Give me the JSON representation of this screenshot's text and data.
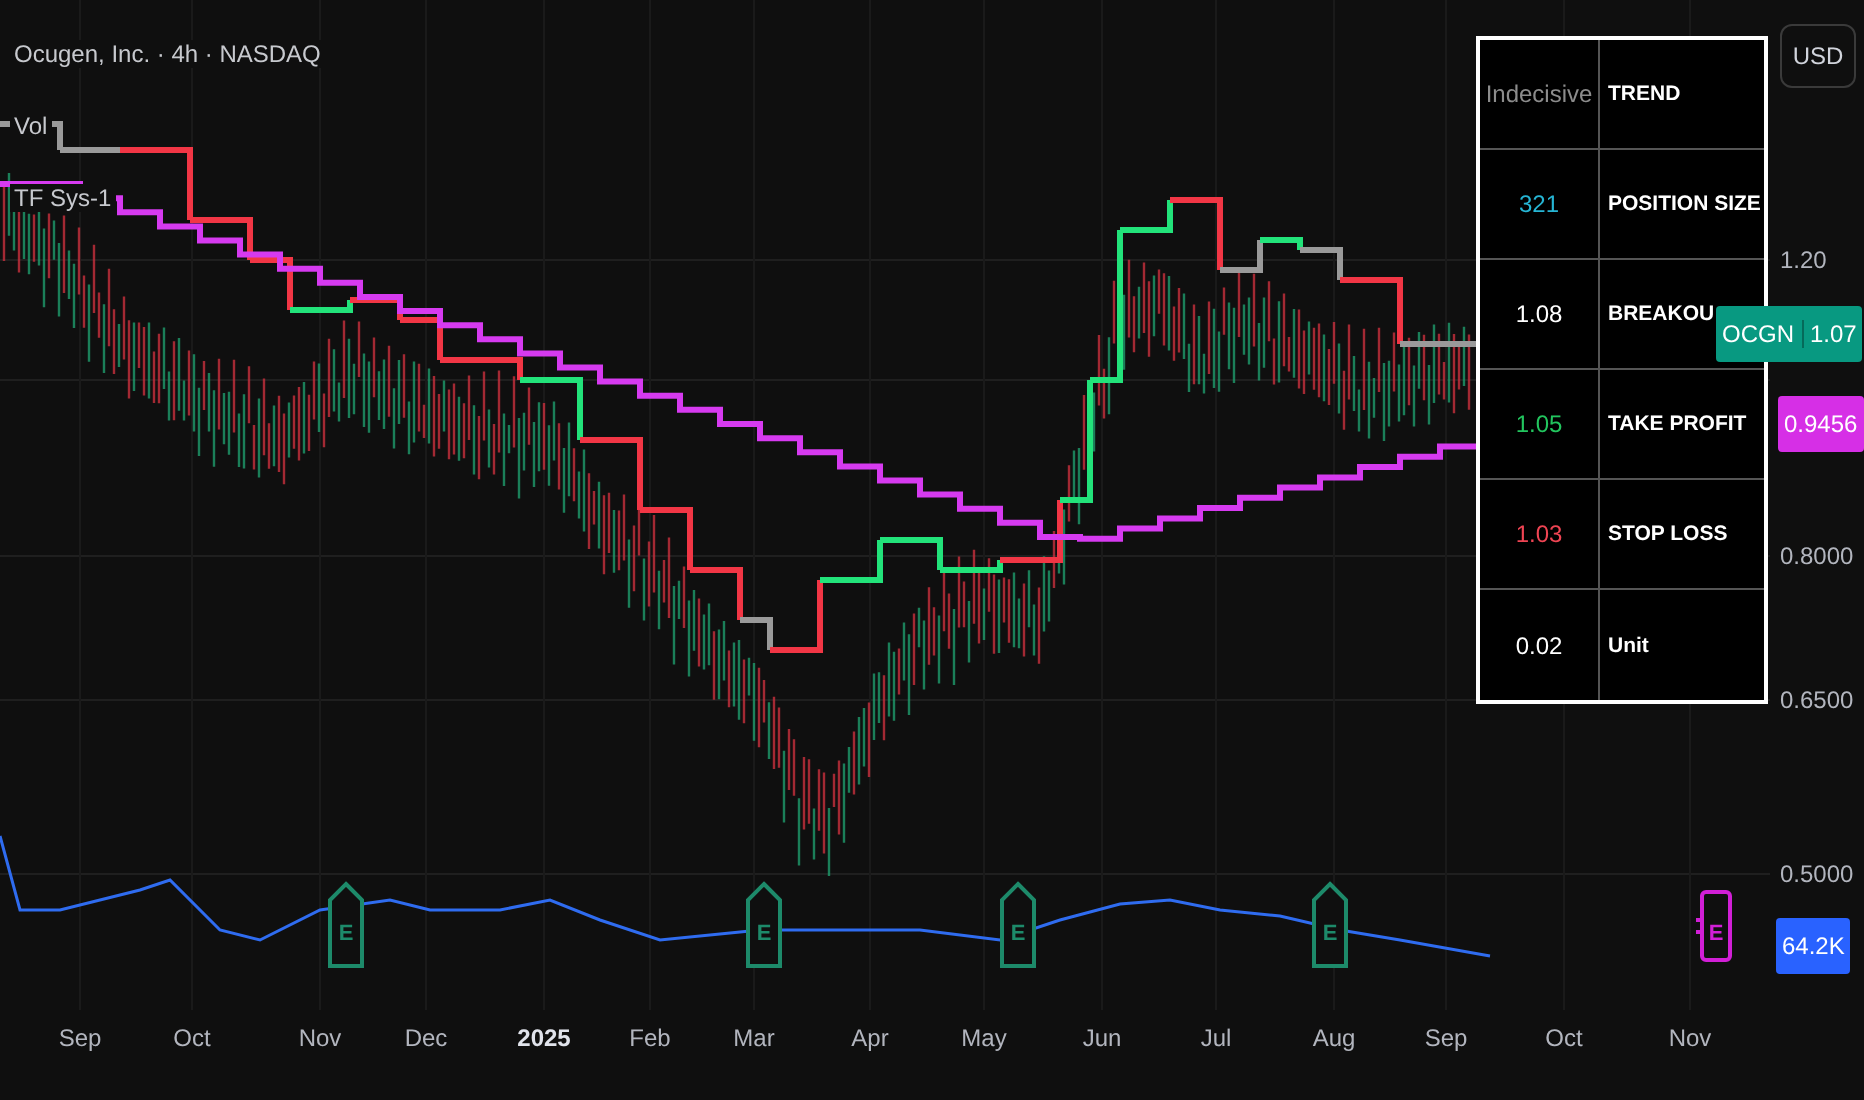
{
  "legend": {
    "title": "Ocugen, Inc. · 4h · NASDAQ",
    "indicators": [
      "Vol",
      "TF Sys-1"
    ]
  },
  "currency_button": "USD",
  "price_axis": {
    "labels": [
      "1.20",
      "0.8000",
      "0.6500",
      "0.5000"
    ]
  },
  "price_badges": [
    {
      "kind": "symbol",
      "symbol": "OCGN",
      "value": "1.07",
      "color": "#089981"
    },
    {
      "kind": "plain",
      "value": "0.9456",
      "color": "#d62fe6"
    },
    {
      "kind": "plain",
      "value": "64.2K",
      "color": "#2962ff"
    }
  ],
  "events": [
    {
      "label": "E",
      "upcoming": false
    },
    {
      "label": "E",
      "upcoming": false
    },
    {
      "label": "E",
      "upcoming": false
    },
    {
      "label": "E",
      "upcoming": false
    },
    {
      "label": "E",
      "upcoming": true
    }
  ],
  "time_axis": [
    {
      "label": "Sep",
      "bold": false
    },
    {
      "label": "Oct",
      "bold": false
    },
    {
      "label": "Nov",
      "bold": false
    },
    {
      "label": "Dec",
      "bold": false
    },
    {
      "label": "2025",
      "bold": true
    },
    {
      "label": "Feb",
      "bold": false
    },
    {
      "label": "Mar",
      "bold": false
    },
    {
      "label": "Apr",
      "bold": false
    },
    {
      "label": "May",
      "bold": false
    },
    {
      "label": "Jun",
      "bold": false
    },
    {
      "label": "Jul",
      "bold": false
    },
    {
      "label": "Aug",
      "bold": false
    },
    {
      "label": "Sep",
      "bold": false
    },
    {
      "label": "Oct",
      "bold": false
    },
    {
      "label": "Nov",
      "bold": false
    }
  ],
  "signal_table": {
    "rows": [
      {
        "value": "Indecisive",
        "label": "TREND",
        "color": "#8c8c8c"
      },
      {
        "value": "321",
        "label": "POSITION SIZE",
        "color": "#26b5d4"
      },
      {
        "value": "1.08",
        "label": "BREAKOU",
        "color": "#ffffff"
      },
      {
        "value": "1.05",
        "label": "TAKE PROFIT",
        "color": "#22c55e"
      },
      {
        "value": "1.03",
        "label": "STOP LOSS",
        "color": "#ef4453"
      },
      {
        "value": "0.02",
        "label": "Unit",
        "color": "#ffffff"
      }
    ]
  }
}
